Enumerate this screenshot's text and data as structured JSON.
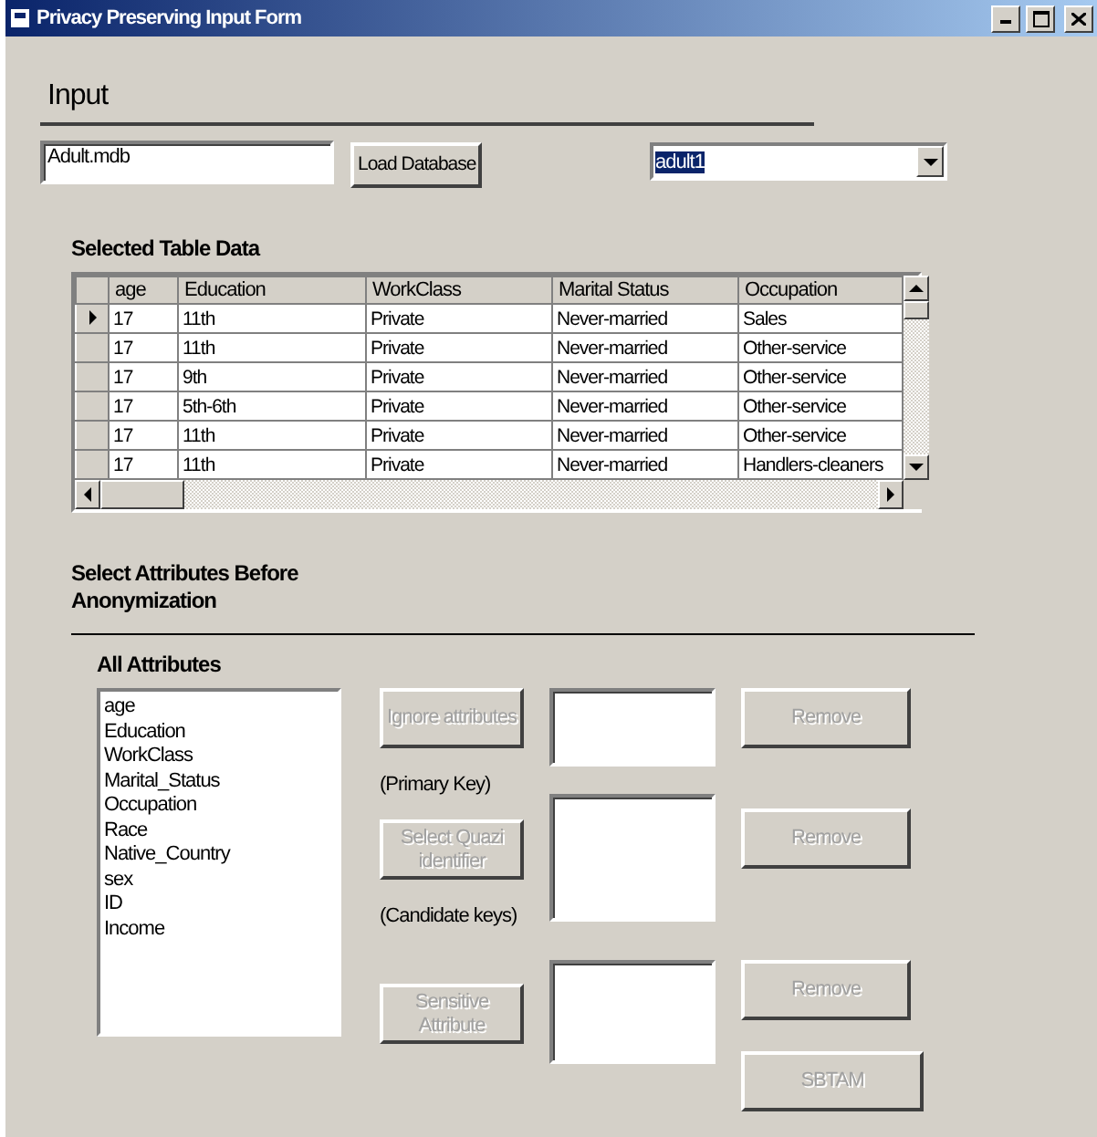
{
  "window": {
    "title": "Privacy Preserving Input Form"
  },
  "input": {
    "heading": "Input",
    "file_field": {
      "value": "Adult.mdb"
    },
    "load_button": {
      "label": "Load Database",
      "disabled": false
    },
    "table_select": {
      "value": "adult1"
    }
  },
  "table": {
    "title": "Selected Table Data",
    "columns": [
      "age",
      "Education",
      "WorkClass",
      "Marital Status",
      "Occupation"
    ],
    "rows": [
      {
        "selected": true,
        "cells": [
          "17",
          "11th",
          "Private",
          "Never-married",
          "Sales"
        ]
      },
      {
        "selected": false,
        "cells": [
          "17",
          "11th",
          "Private",
          "Never-married",
          "Other-service"
        ]
      },
      {
        "selected": false,
        "cells": [
          "17",
          "9th",
          "Private",
          "Never-married",
          "Other-service"
        ]
      },
      {
        "selected": false,
        "cells": [
          "17",
          "5th-6th",
          "Private",
          "Never-married",
          "Other-service"
        ]
      },
      {
        "selected": false,
        "cells": [
          "17",
          "11th",
          "Private",
          "Never-married",
          "Other-service"
        ]
      },
      {
        "selected": false,
        "cells": [
          "17",
          "11th",
          "Private",
          "Never-married",
          "Handlers-cleaners"
        ]
      }
    ]
  },
  "attributes": {
    "heading": "Select Attributes Before Anonymization",
    "list_title": "All  Attributes",
    "items": [
      "age",
      "Education",
      "WorkClass",
      "Marital_Status",
      "Occupation",
      "Race",
      "Native_Country",
      "sex",
      "ID",
      "Income"
    ],
    "ignore_button": {
      "label": "Ignore attributes",
      "disabled": true
    },
    "primary_key_label": "(Primary Key)",
    "quasi_button": {
      "label": "Select Quazi identifier",
      "disabled": true
    },
    "candidate_keys_label": "(Candidate keys)",
    "sensitive_button": {
      "label": "Sensitive Attribute",
      "disabled": true
    },
    "remove_buttons": [
      {
        "label": "Remove",
        "disabled": true
      },
      {
        "label": "Remove",
        "disabled": true
      },
      {
        "label": "Remove",
        "disabled": true
      }
    ],
    "sbtam_button": {
      "label": "SBTAM",
      "disabled": true
    }
  }
}
